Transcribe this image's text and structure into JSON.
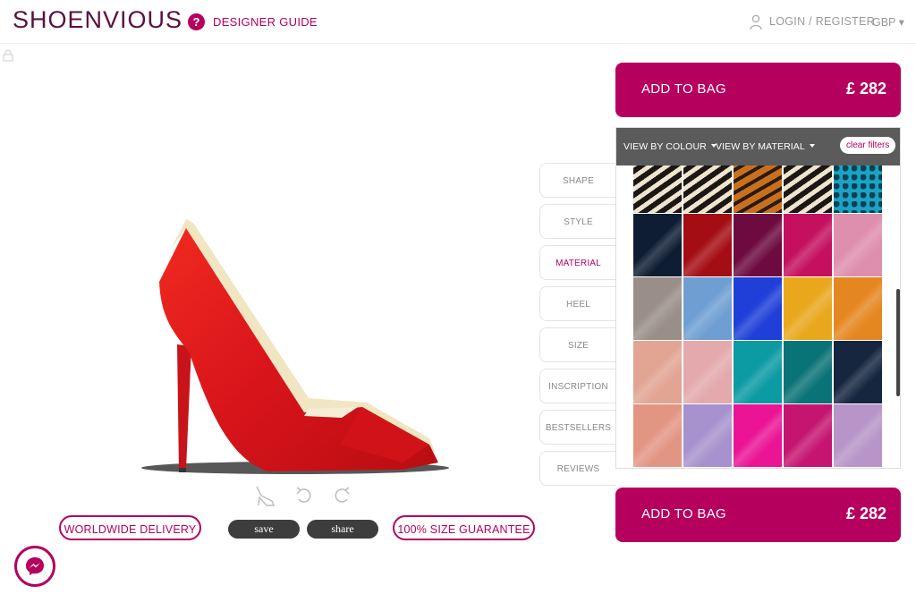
{
  "header": {
    "logo": "SHOENVIOUS",
    "guide_icon": "?",
    "designer_guide": "DESIGNER GUIDE",
    "login": "LOGIN / REGISTER",
    "currency": "GBP ▾"
  },
  "tabs": [
    {
      "label": "SHAPE",
      "active": false
    },
    {
      "label": "STYLE",
      "active": false
    },
    {
      "label": "MATERIAL",
      "active": true
    },
    {
      "label": "HEEL",
      "active": false
    },
    {
      "label": "SIZE",
      "active": false
    },
    {
      "label": "INSCRIPTION",
      "active": false
    },
    {
      "label": "BESTSELLERS",
      "active": false
    },
    {
      "label": "REVIEWS",
      "active": false
    }
  ],
  "bag_top": {
    "label": "ADD TO BAG",
    "price": "£ 282"
  },
  "bag_bottom": {
    "label": "ADD TO BAG",
    "price": "£ 282"
  },
  "filters": {
    "colour": "VIEW BY COLOUR",
    "material": "VIEW BY MATERIAL",
    "clear": "clear filters"
  },
  "swatch_rows": [
    [
      "zebra-print",
      "zebra-print",
      "tiger-print",
      "zebra-print",
      "teal-leopard-print"
    ],
    [
      "#0f1d33",
      "#a50d14",
      "#6d0a3f",
      "#c4105f",
      "#de8fae"
    ],
    [
      "#9a8f88",
      "#6f9fd2",
      "#1f3fd8",
      "#e9a81c",
      "#e58721"
    ],
    [
      "#e2a493",
      "#e3a9ad",
      "#0c9aa3",
      "#0a7377",
      "#16263f"
    ],
    [
      "#e39584",
      "#a892cd",
      "#ea1495",
      "#c51570",
      "#b795c8"
    ]
  ],
  "actions": {
    "worldwide": "WORLDWIDE DELIVERY",
    "save": "save",
    "share": "share",
    "guarantee": "100% SIZE GUARANTEE"
  },
  "colors": {
    "brand": "#b5005e",
    "shoe": "#e0161b",
    "panel_bar": "#5b5b5b"
  }
}
